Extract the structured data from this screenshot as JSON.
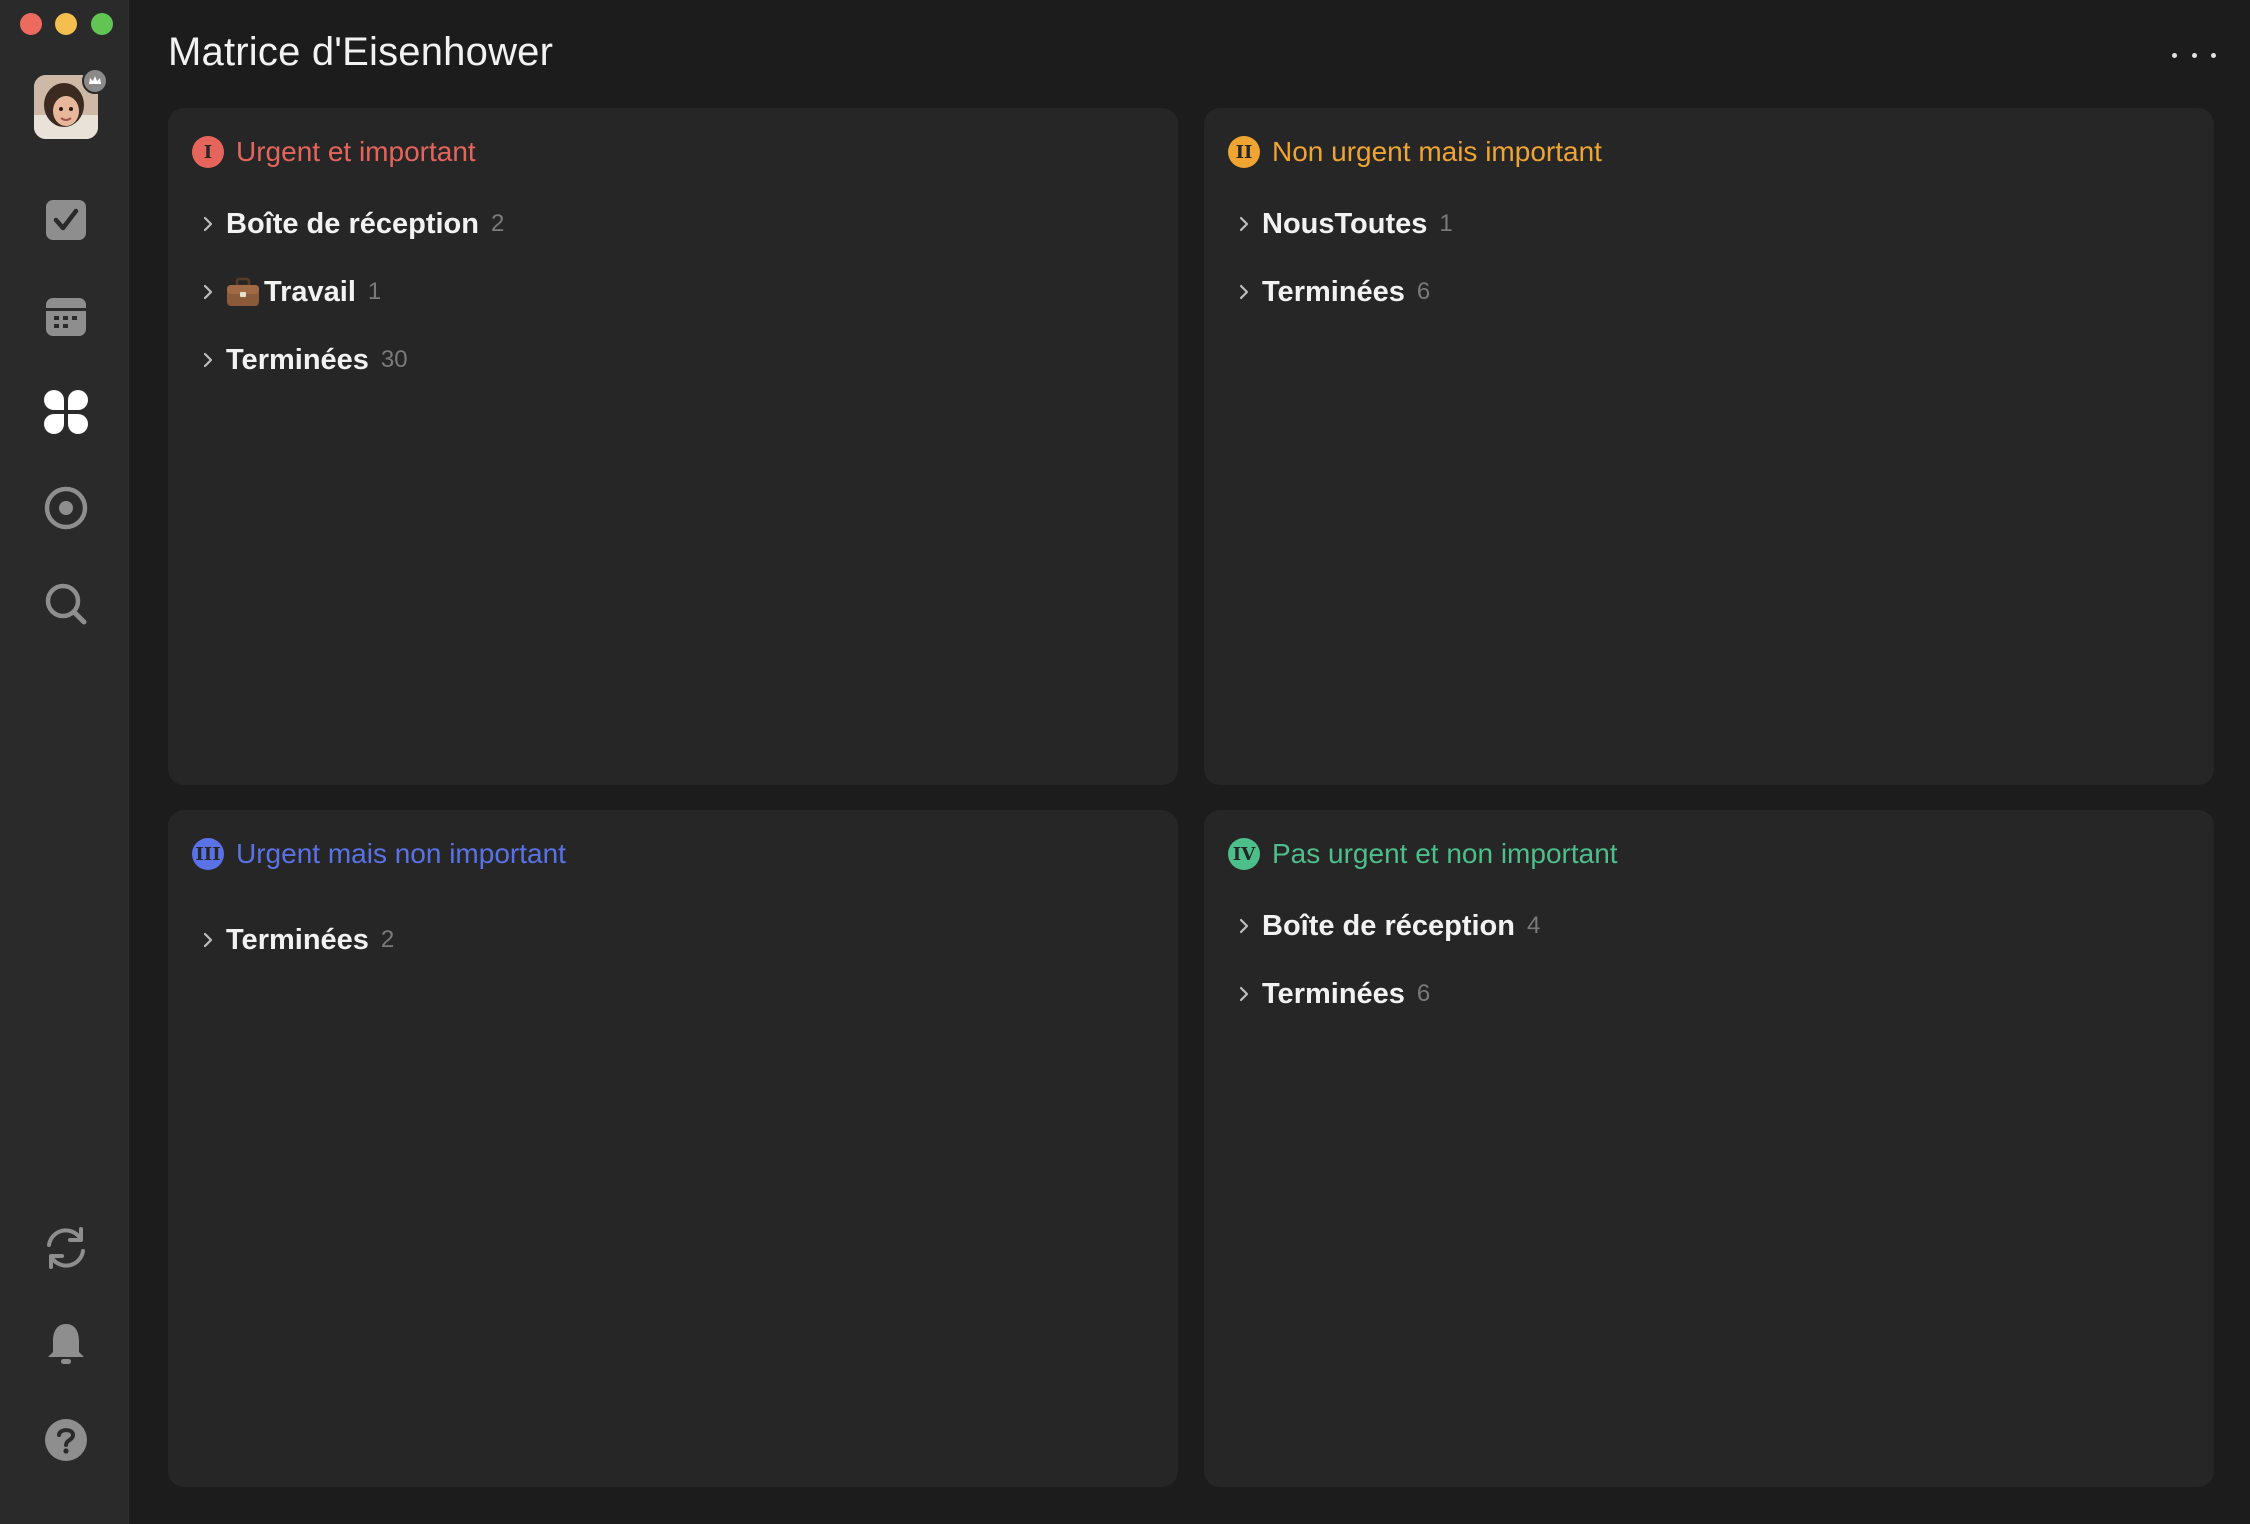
{
  "window": {
    "title": "Matrice d'Eisenhower"
  },
  "sidebar": {
    "items": [
      {
        "name": "tasks",
        "icon": "checkbox-icon"
      },
      {
        "name": "calendar",
        "icon": "calendar-icon"
      },
      {
        "name": "matrix",
        "icon": "matrix-icon",
        "active": true
      },
      {
        "name": "focus",
        "icon": "focus-icon"
      },
      {
        "name": "search",
        "icon": "search-icon"
      }
    ],
    "bottom_items": [
      {
        "name": "sync",
        "icon": "sync-icon"
      },
      {
        "name": "notifications",
        "icon": "bell-icon"
      },
      {
        "name": "help",
        "icon": "help-icon"
      }
    ]
  },
  "header": {
    "more_icon": "more-icon"
  },
  "quadrants": [
    {
      "badge": "I",
      "title": "Urgent et important",
      "color": "#e5655d",
      "groups": [
        {
          "name": "Boîte de réception",
          "count": "2"
        },
        {
          "name": "Travail",
          "count": "1",
          "emoji": "briefcase"
        },
        {
          "name": "Terminées",
          "count": "30"
        }
      ]
    },
    {
      "badge": "II",
      "title": "Non urgent mais important",
      "color": "#f0a431",
      "groups": [
        {
          "name": "NousToutes",
          "count": "1"
        },
        {
          "name": "Terminées",
          "count": "6"
        }
      ]
    },
    {
      "badge": "III",
      "title": "Urgent mais non important",
      "color": "#5b72e6",
      "groups": [
        {
          "name": "Terminées",
          "count": "2"
        }
      ]
    },
    {
      "badge": "IV",
      "title": "Pas urgent et non important",
      "color": "#4cbf8a",
      "groups": [
        {
          "name": "Boîte de réception",
          "count": "4"
        },
        {
          "name": "Terminées",
          "count": "6"
        }
      ]
    }
  ]
}
